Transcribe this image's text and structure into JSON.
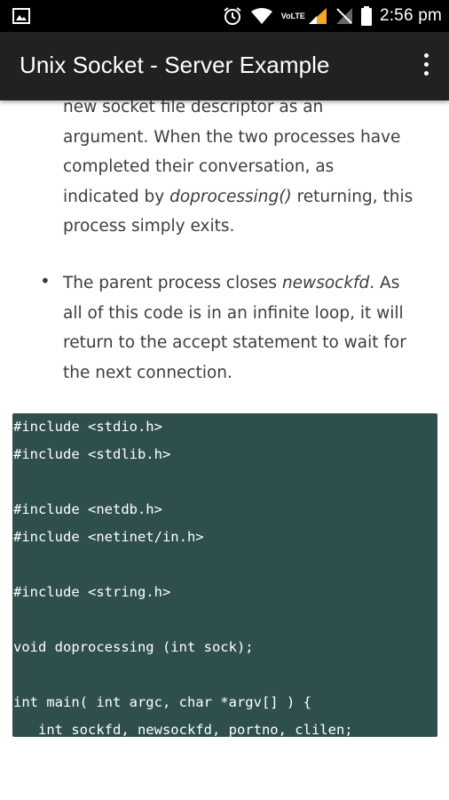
{
  "status_bar": {
    "time": "2:56 pm",
    "network": "VoLTE",
    "icons": [
      "image-icon",
      "alarm-icon",
      "wifi-icon",
      "signal-icon",
      "no-signal-icon",
      "battery-icon"
    ]
  },
  "app_bar": {
    "title": "Unix Socket - Server Example",
    "menu_icon": "more-vert-icon"
  },
  "article": {
    "para1_lines": [
      "new socket file descriptor as an",
      "argument. When the two processes have",
      "completed their conversation, as",
      "returning, this",
      "process simply exits."
    ],
    "para1_line4_prefix": "indicated by ",
    "para1_line4_italic": "doprocessing()",
    "bullet_char": "•",
    "para2_line1_prefix": "The parent process closes ",
    "para2_line1_italic": "newsockfd",
    "para2_line1_suffix": ". As",
    "para2_lines": [
      "all of this code is in an infinite loop, it will",
      "return to the accept statement to wait for",
      "the next connection."
    ]
  },
  "code": {
    "lines": [
      "#include <stdio.h>",
      "#include <stdlib.h>",
      "",
      "#include <netdb.h>",
      "#include <netinet/in.h>",
      "",
      "#include <string.h>",
      "",
      "void doprocessing (int sock);",
      "",
      "int main( int argc, char *argv[] ) {",
      "   int sockfd, newsockfd, portno, clilen;"
    ]
  },
  "colors": {
    "status_bar_bg": "#000000",
    "app_bar_bg": "#212121",
    "body_text": "#3d3d3d",
    "code_bg": "#2f4f4f",
    "code_text": "#ffffff"
  }
}
